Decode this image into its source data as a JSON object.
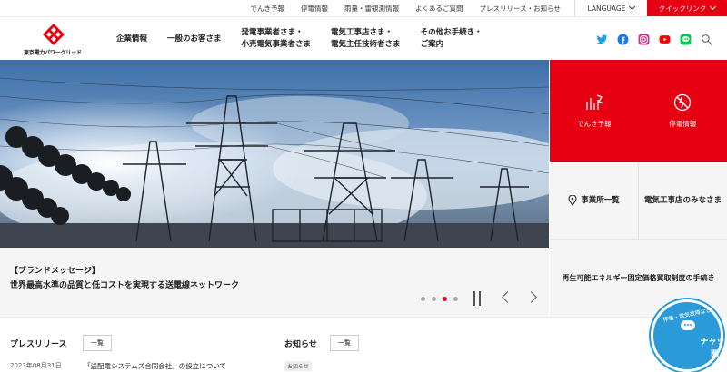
{
  "utility": {
    "links": [
      "でんき予報",
      "停電情報",
      "雨量・雷観測情報",
      "よくあるご質問",
      "プレスリリース・お知らせ"
    ],
    "language": "LANGUAGE",
    "quicklink": "クイックリンク"
  },
  "logo": {
    "text": "東京電力パワーグリッド"
  },
  "nav": {
    "items": [
      "企業情報",
      "一般のお客さま",
      "発電事業者さま・\n小売電気事業者さま",
      "電気工事店さま・\n電気主任技術者さま",
      "その他お手続き・\nご案内"
    ]
  },
  "sns": [
    "twitter-icon",
    "facebook-icon",
    "instagram-icon",
    "youtube-icon",
    "line-icon",
    "search-icon"
  ],
  "hero": {
    "caption1": "【ブランドメッセージ】",
    "caption2": "世界最高水準の品質と低コストを実現する送電線ネットワーク",
    "dots": 3,
    "active_dot": 2
  },
  "right": {
    "red_items": [
      "でんき予報",
      "停電情報"
    ],
    "grey_items": [
      "事業所一覧",
      "電気工事店のみなさま"
    ],
    "renew": "再生可能エネルギー固定価格買取制度の手続き"
  },
  "news": {
    "press_title": "プレスリリース",
    "notice_title": "お知らせ",
    "more": "一覧",
    "date": "2023年08月31日",
    "press_item": "「送配電システムズ合同会社」の設立について",
    "notice_tag": "お知らせ"
  },
  "chat": {
    "small": "停電・電気故障など",
    "line1": "チャットで",
    "line2": "聞く!"
  },
  "colors": {
    "brand_red": "#e60012",
    "chat_blue": "#2a9ad9"
  }
}
